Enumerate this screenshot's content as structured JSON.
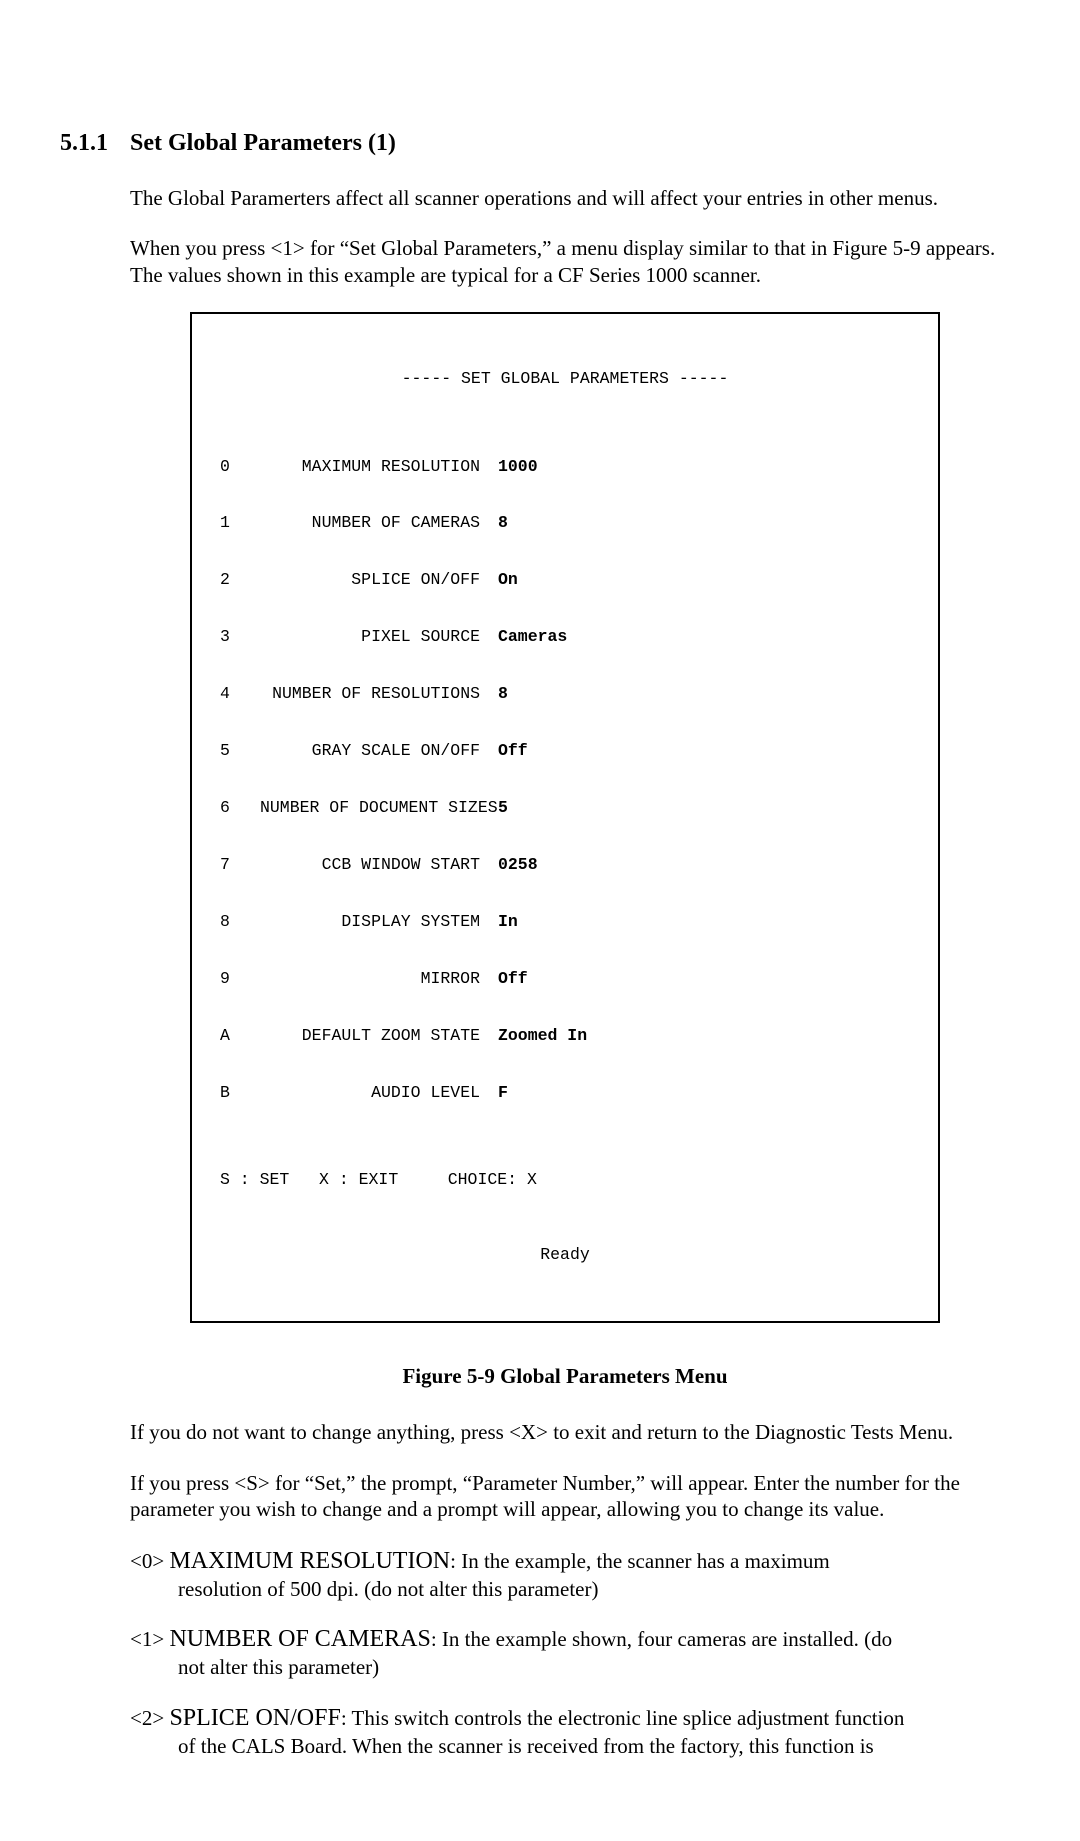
{
  "heading": {
    "number": "5.1.1",
    "title": "Set Global Parameters  (1)"
  },
  "intro": {
    "p1": "The Global Paramerters affect all scanner operations and will affect your entries in other menus.",
    "p2": "When you press <1> for “Set Global Parameters,” a menu display similar to that in Figure 5-9 appears.  The values shown in this example are typical for a CF Series 1000 scanner."
  },
  "menu": {
    "title": "----- SET GLOBAL PARAMETERS -----",
    "rows": [
      {
        "key": "0",
        "label": "MAXIMUM RESOLUTION",
        "value": "1000"
      },
      {
        "key": "1",
        "label": "NUMBER OF CAMERAS",
        "value": "8"
      },
      {
        "key": "2",
        "label": "SPLICE ON/OFF",
        "value": "On"
      },
      {
        "key": "3",
        "label": "PIXEL SOURCE",
        "value": "Cameras"
      },
      {
        "key": "4",
        "label": "NUMBER OF RESOLUTIONS",
        "value": "8"
      },
      {
        "key": "5",
        "label": "GRAY SCALE ON/OFF",
        "value": "Off"
      },
      {
        "key": "6",
        "label": "NUMBER OF DOCUMENT SIZES",
        "value": "5"
      },
      {
        "key": "7",
        "label": "CCB WINDOW START",
        "value": "0258"
      },
      {
        "key": "8",
        "label": "DISPLAY SYSTEM",
        "value": "In"
      },
      {
        "key": "9",
        "label": "MIRROR",
        "value": "Off"
      },
      {
        "key": "A",
        "label": "DEFAULT ZOOM STATE",
        "value": "Zoomed In"
      },
      {
        "key": "B",
        "label": "AUDIO LEVEL",
        "value": "F"
      }
    ],
    "footer": "S : SET   X : EXIT     CHOICE: X",
    "ready": "Ready"
  },
  "figure_caption": "Figure 5-9 Global Parameters Menu",
  "after": {
    "p1": "If you do not want to change anything, press <X> to exit and return to the Diagnostic Tests Menu.",
    "p2": "If you press <S> for “Set,” the prompt, “Parameter Number,” will appear.  Enter the number for the parameter you wish to change and a prompt will appear, allowing you to change its value."
  },
  "defs": [
    {
      "key": "<0> ",
      "name": "MAXIMUM RESOLUTION",
      "colon": ":  ",
      "text_first": "In the example, the scanner has a maximum",
      "text_rest": "resolution of 500 dpi.  (do not alter this parameter)"
    },
    {
      "key": "<1> ",
      "name": "NUMBER OF CAMERAS",
      "colon": ":  ",
      "text_first": "In the example shown, four cameras are installed.  (do",
      "text_rest": "not alter this parameter)"
    },
    {
      "key": "<2> ",
      "name": "SPLICE ON/OFF",
      "colon": ":  ",
      "text_first": "This switch controls the electronic line splice adjustment function",
      "text_rest": "of the CALS Board.  When the scanner is received from the factory, this function is"
    }
  ]
}
